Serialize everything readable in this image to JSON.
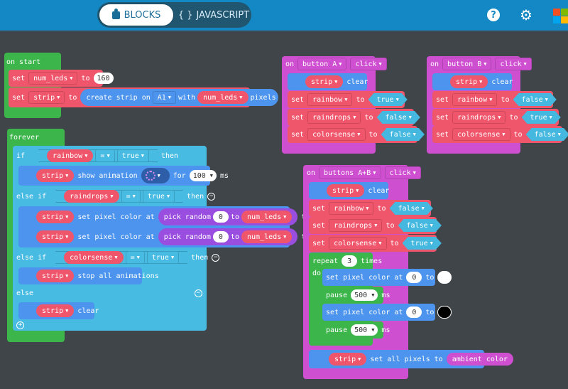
{
  "header": {
    "tabs": [
      {
        "label": "BLOCKS",
        "icon": "puzzle-icon",
        "active": true
      },
      {
        "label": "JAVASCRIPT",
        "icon": "braces-icon",
        "active": false
      }
    ],
    "help_icon": "?",
    "gear_icon": "⚙",
    "logo_colors": [
      "#f25022",
      "#7fba00",
      "#00a4ef",
      "#ffb900"
    ]
  },
  "on_start": {
    "label": "on start",
    "set1": {
      "set": "set",
      "var": "num_leds",
      "to": "to",
      "value": "160"
    },
    "set2": {
      "set": "set",
      "var": "strip",
      "to": "to",
      "create": "create strip on",
      "pin": "A1",
      "with": "with",
      "arg": "num_leds",
      "pixels": "pixels"
    }
  },
  "forever": {
    "label": "forever",
    "if1": {
      "if": "if",
      "var": "rainbow",
      "op": "=",
      "value": "true",
      "then": "then"
    },
    "anim": {
      "target": "strip",
      "action": "show animation",
      "for": "for",
      "ms_value": "100",
      "ms": "ms"
    },
    "if2": {
      "if": "else if",
      "var": "raindrops",
      "op": "=",
      "value": "true",
      "then": "then"
    },
    "pix1": {
      "target": "strip",
      "action": "set pixel color at",
      "pick": "pick random",
      "from": "0",
      "to": "to",
      "var": "num_leds",
      "to2": "to"
    },
    "pix2": {
      "target": "strip",
      "action": "set pixel color at",
      "pick": "pick random",
      "from": "0",
      "to": "to",
      "var": "num_leds",
      "to2": "to"
    },
    "if3": {
      "if": "else if",
      "var": "colorsense",
      "op": "=",
      "value": "true",
      "then": "then"
    },
    "stop": {
      "target": "strip",
      "action": "stop all animations"
    },
    "else": "else",
    "clear": {
      "target": "strip",
      "action": "clear"
    }
  },
  "button_a": {
    "on": "on",
    "button": "button A",
    "event": "click",
    "clear": {
      "target": "strip",
      "action": "clear"
    },
    "sets": [
      {
        "set": "set",
        "var": "rainbow",
        "to": "to",
        "value": "true"
      },
      {
        "set": "set",
        "var": "raindrops",
        "to": "to",
        "value": "false"
      },
      {
        "set": "set",
        "var": "colorsense",
        "to": "to",
        "value": "false"
      }
    ]
  },
  "button_b": {
    "on": "on",
    "button": "button B",
    "event": "click",
    "clear": {
      "target": "strip",
      "action": "clear"
    },
    "sets": [
      {
        "set": "set",
        "var": "rainbow",
        "to": "to",
        "value": "false"
      },
      {
        "set": "set",
        "var": "raindrops",
        "to": "to",
        "value": "true"
      },
      {
        "set": "set",
        "var": "colorsense",
        "to": "to",
        "value": "false"
      }
    ]
  },
  "button_ab": {
    "on": "on",
    "button": "buttons A+B",
    "event": "click",
    "clear": {
      "target": "strip",
      "action": "clear"
    },
    "sets": [
      {
        "set": "set",
        "var": "rainbow",
        "to": "to",
        "value": "false"
      },
      {
        "set": "set",
        "var": "raindrops",
        "to": "to",
        "value": "false"
      },
      {
        "set": "set",
        "var": "colorsense",
        "to": "to",
        "value": "true"
      }
    ],
    "repeat": {
      "label": "repeat",
      "count": "3",
      "times": "times",
      "do": "do"
    },
    "pixw": {
      "action": "set pixel color at",
      "index": "0",
      "to": "to"
    },
    "pause1": {
      "label": "pause",
      "value": "500",
      "ms": "ms"
    },
    "pixb": {
      "action": "set pixel color at",
      "index": "0",
      "to": "to"
    },
    "pause2": {
      "label": "pause",
      "value": "500",
      "ms": "ms"
    },
    "all": {
      "target": "strip",
      "action": "set all pixels to",
      "value": "ambient color"
    }
  }
}
